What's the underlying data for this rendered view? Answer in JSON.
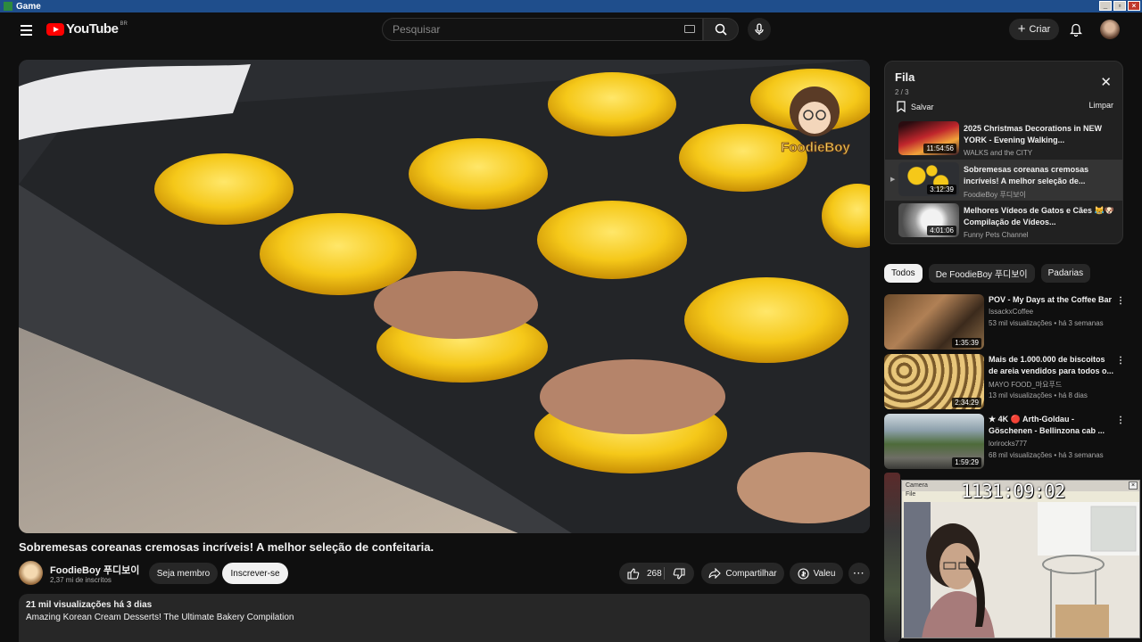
{
  "window": {
    "title": "Game"
  },
  "header": {
    "logo_text": "YouTube",
    "country_code": "BR",
    "search_placeholder": "Pesquisar",
    "create_label": "Criar"
  },
  "video": {
    "title": "Sobremesas coreanas cremosas incríveis! A melhor seleção de confeitaria.",
    "watermark": "FoodieBoy",
    "channel_name": "FoodieBoy 푸디보이",
    "channel_subs": "2,37 mi de inscritos",
    "member_label": "Seja membro",
    "subscribe_label": "Inscrever-se",
    "likes": "268",
    "share_label": "Compartilhar",
    "thanks_label": "Valeu",
    "views_line": "21 mil visualizações  há 3 dias",
    "description": "Amazing Korean Cream Desserts! The Ultimate Bakery Compilation"
  },
  "queue": {
    "title": "Fila",
    "count": "2 / 3",
    "save_label": "Salvar",
    "clear_label": "Limpar",
    "items": [
      {
        "title": "2025 Christmas Decorations in NEW YORK - Evening Walking...",
        "channel": "WALKS and the CITY",
        "duration": "11:54:56",
        "active": false
      },
      {
        "title": "Sobremesas coreanas cremosas incríveis! A melhor seleção de...",
        "channel": "FoodieBoy 푸디보이",
        "duration": "3:12:39",
        "active": true
      },
      {
        "title": "Melhores Vídeos de Gatos e Cães 😹🐶 Compilação de Vídeos...",
        "channel": "Funny Pets Channel",
        "duration": "4:01:06",
        "active": false
      }
    ]
  },
  "chips": [
    {
      "label": "Todos",
      "selected": true
    },
    {
      "label": "De FoodieBoy 푸디보이",
      "selected": false
    },
    {
      "label": "Padarias",
      "selected": false
    }
  ],
  "recommendations": [
    {
      "title": "POV - My Days at the Coffee Bar",
      "channel": "IssackxCoffee",
      "meta": "53 mil visualizações • há 3 semanas",
      "duration": "1:35:39"
    },
    {
      "title": "Mais de 1.000.000 de biscoitos de areia vendidos para todos o...",
      "channel": "MAYO FOOD_마요푸드",
      "meta": "13 mil visualizações • há 8 dias",
      "duration": "2:34:29"
    },
    {
      "title": "★ 4K 🔴 Arth-Goldau - Göschenen - Bellinzona cab ...",
      "channel": "lorirocks777",
      "meta": "68 mil visualizações • há 3 semanas",
      "duration": "1:59:29"
    }
  ],
  "webcam": {
    "window_title": "Camera",
    "menu": "File",
    "clock": "1131:09:02"
  }
}
